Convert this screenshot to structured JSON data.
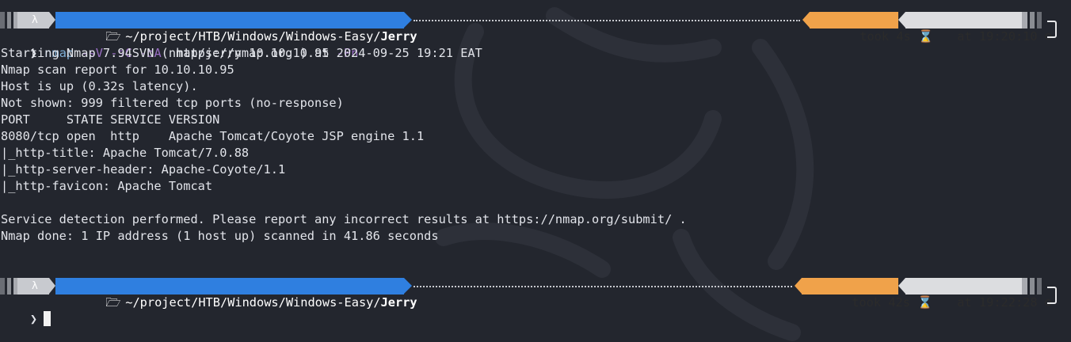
{
  "prompt1": {
    "os_icon": "λ",
    "folder_icon": "folder-icon",
    "path_prefix": "~/project/HTB/Windows/Windows-Easy/",
    "path_leaf": "Jerry",
    "took_text": "took 4s",
    "took_icon": "⌛",
    "time_text": "at 19:20:10",
    "clock_icon": "⊙"
  },
  "command": {
    "chevron": "❯",
    "name": "nmap",
    "flag1": "-sV",
    "flag2": "-sC",
    "flag3": "-oA",
    "arg1": "nmap/jerry",
    "arg2": "10.10.10.95",
    "flag4": "-Pn"
  },
  "output": [
    "Starting Nmap 7.94SVN ( https://nmap.org ) at 2024-09-25 19:21 EAT",
    "Nmap scan report for 10.10.10.95",
    "Host is up (0.32s latency).",
    "Not shown: 999 filtered tcp ports (no-response)",
    "PORT     STATE SERVICE VERSION",
    "8080/tcp open  http    Apache Tomcat/Coyote JSP engine 1.1",
    "|_http-title: Apache Tomcat/7.0.88",
    "|_http-server-header: Apache-Coyote/1.1",
    "|_http-favicon: Apache Tomcat",
    "",
    "Service detection performed. Please report any incorrect results at https://nmap.org/submit/ .",
    "Nmap done: 1 IP address (1 host up) scanned in 41.86 seconds"
  ],
  "prompt2": {
    "os_icon": "λ",
    "folder_icon": "folder-icon",
    "path_prefix": "~/project/HTB/Windows/Windows-Easy/",
    "path_leaf": "Jerry",
    "took_text": "took 42s",
    "took_icon": "⌛",
    "time_text": "at 19:22:28",
    "clock_icon": "⊙"
  },
  "input_line": {
    "chevron": "❯",
    "value": ""
  },
  "colors": {
    "background": "#23262e",
    "path_segment": "#2f7fe0",
    "took_segment": "#f0a24a",
    "time_segment": "#dcdde0",
    "command_name": "#7fb0d8",
    "command_flag": "#9a6fc4"
  }
}
